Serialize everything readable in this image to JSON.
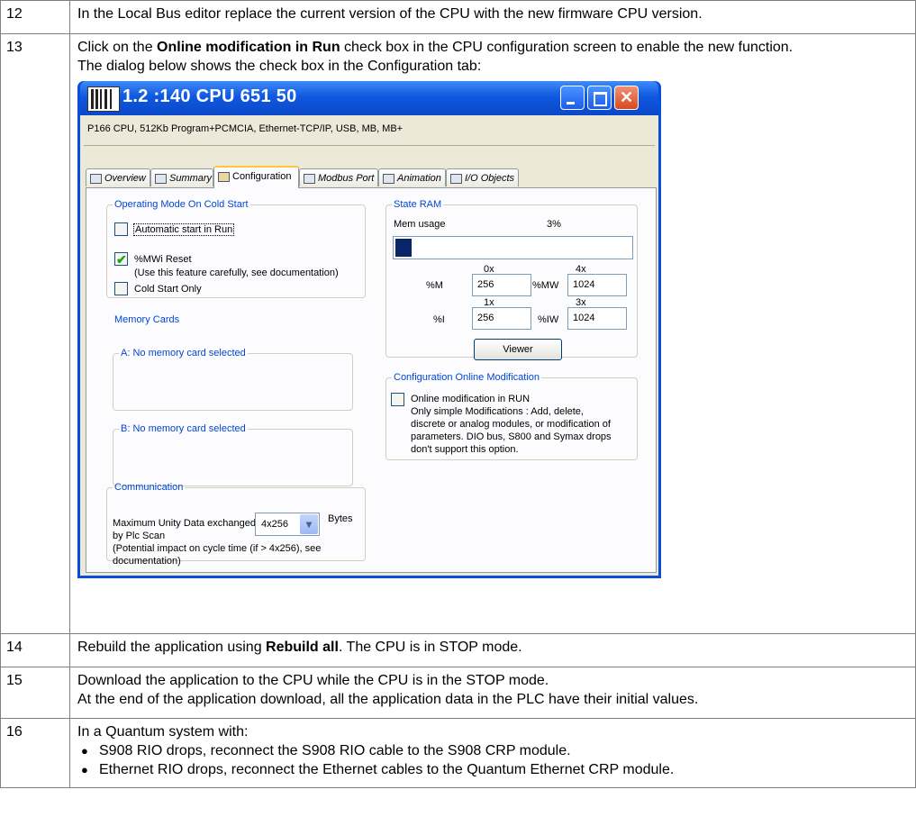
{
  "rows": [
    {
      "num": "12",
      "text": "In the Local Bus editor replace the current version of the CPU with the new firmware CPU version."
    },
    {
      "num": "13",
      "pre": "Click on the ",
      "bold": "Online modification in Run",
      "post": " check box in the CPU configuration screen to enable the new function.",
      "line2": "The dialog below shows the check box in the Configuration tab:"
    },
    {
      "num": "14",
      "pre": "Rebuild the application using ",
      "bold": "Rebuild all",
      "post": ". The CPU is in STOP mode."
    },
    {
      "num": "15",
      "line1": "Download the application to the CPU while the CPU is in the STOP mode.",
      "line2": "At the end of the application download, all the application data in the PLC have their initial values."
    },
    {
      "num": "16",
      "intro": "In a Quantum system with:",
      "bullets": [
        "S908 RIO drops, reconnect the S908 RIO cable to the S908 CRP module.",
        "Ethernet RIO drops, reconnect the Ethernet cables to the Quantum Ethernet CRP module."
      ]
    }
  ],
  "dialog": {
    "title": "1.2 :140 CPU 651 50",
    "description": "P166 CPU, 512Kb Program+PCMCIA, Ethernet-TCP/IP, USB, MB, MB+",
    "window_buttons": {
      "minimize": "_",
      "maximize": "□",
      "close": "✕"
    },
    "tabs": [
      "Overview",
      "Summary",
      "Configuration",
      "Modbus Port",
      "Animation",
      "I/O Objects"
    ],
    "active_tab": "Configuration",
    "cold_start": {
      "legend": "Operating Mode On Cold Start",
      "automatic_start": {
        "label": "Automatic start in Run",
        "checked": false
      },
      "mwi_reset": {
        "label": "%MWi Reset",
        "checked": true,
        "note": "(Use this feature carefully, see documentation)"
      },
      "cold_start_only": {
        "label": "Cold Start Only",
        "checked": false
      }
    },
    "memory_cards": {
      "legend": "Memory Cards",
      "card_a": "A: No memory card selected",
      "card_b": "B: No memory card selected"
    },
    "communication": {
      "legend": "Communication",
      "label_line1": "Maximum Unity Data exchanged",
      "label_line2": "by Plc Scan",
      "select_value": "4x256",
      "unit": "Bytes",
      "note_line1": "(Potential impact on cycle time (if > 4x256), see",
      "note_line2": "documentation)"
    },
    "state_ram": {
      "legend": "State RAM",
      "mem_usage_label": "Mem usage",
      "mem_usage_percent": "3%",
      "mem_usage_fraction": 0.07,
      "col_0x": "0x",
      "col_4x": "4x",
      "col_1x": "1x",
      "col_3x": "3x",
      "m_label": "%M",
      "m_value": "256",
      "mw_label": "%MW",
      "mw_value": "1024",
      "i_label": "%I",
      "i_value": "256",
      "iw_label": "%IW",
      "iw_value": "1024",
      "viewer_button": "Viewer"
    },
    "online_mod": {
      "legend": "Configuration Online Modification",
      "checkbox_label": "Online modification in RUN",
      "checked": false,
      "desc_lines": [
        "Only simple Modifications : Add, delete,",
        "discrete or analog modules, or modification of",
        "parameters. DIO bus, S800 and Symax drops",
        "don't support this option."
      ]
    }
  },
  "colors": {
    "title_bar": "#0a4fd8",
    "group_legend": "#0046d5",
    "check_mark": "#21a121",
    "mem_fill": "#0a246a",
    "close_button": "#d84a1e"
  }
}
